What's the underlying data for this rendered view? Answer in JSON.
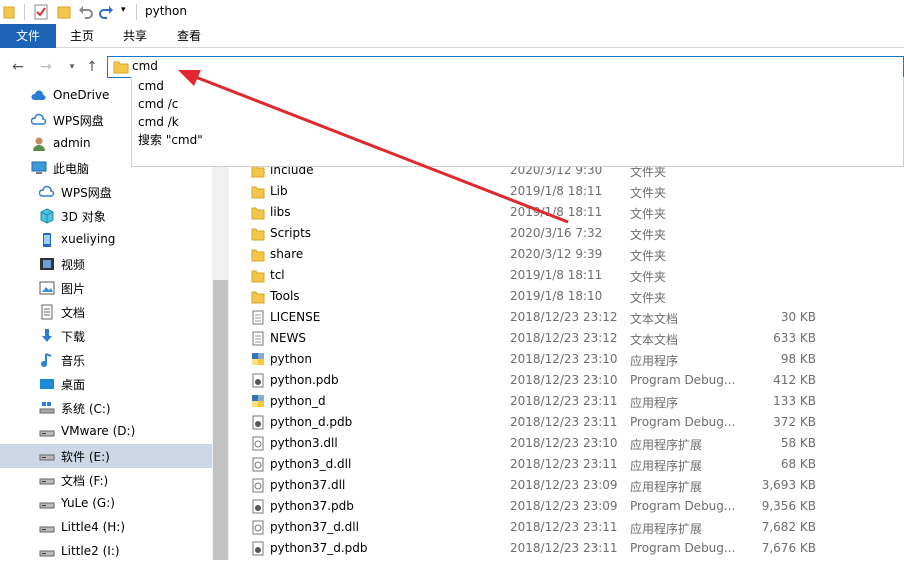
{
  "window": {
    "title": "python"
  },
  "ribbon": {
    "tabs": [
      "文件",
      "主页",
      "共享",
      "查看"
    ]
  },
  "address": {
    "value": "cmd",
    "suggestions": [
      "cmd",
      "cmd /c",
      "cmd /k",
      "搜索 \"cmd\""
    ]
  },
  "sidebar": {
    "items": [
      {
        "label": "OneDrive",
        "icon": "cloud-icon"
      },
      {
        "label": "WPS网盘",
        "icon": "wps-cloud-icon"
      },
      {
        "label": "admin",
        "icon": "user-icon"
      },
      {
        "label": "此电脑",
        "icon": "computer-icon"
      },
      {
        "label": "WPS网盘",
        "icon": "wps-cloud-icon"
      },
      {
        "label": "3D 对象",
        "icon": "cube-icon"
      },
      {
        "label": "xueliying",
        "icon": "phone-icon"
      },
      {
        "label": "视频",
        "icon": "video-icon"
      },
      {
        "label": "图片",
        "icon": "picture-icon"
      },
      {
        "label": "文档",
        "icon": "document-icon"
      },
      {
        "label": "下载",
        "icon": "download-icon"
      },
      {
        "label": "音乐",
        "icon": "music-icon"
      },
      {
        "label": "桌面",
        "icon": "desktop-icon"
      },
      {
        "label": "系统 (C:)",
        "icon": "system-drive-icon"
      },
      {
        "label": "VMware (D:)",
        "icon": "drive-icon"
      },
      {
        "label": "软件 (E:)",
        "icon": "drive-icon"
      },
      {
        "label": "文档 (F:)",
        "icon": "drive-icon"
      },
      {
        "label": "YuLe (G:)",
        "icon": "drive-icon"
      },
      {
        "label": "Little4 (H:)",
        "icon": "drive-icon"
      },
      {
        "label": "Little2 (I:)",
        "icon": "drive-icon"
      }
    ]
  },
  "files": [
    {
      "name": "include",
      "date": "2020/3/12 9:30",
      "type": "文件夹",
      "size": "",
      "icon": "folder-icon"
    },
    {
      "name": "Lib",
      "date": "2019/1/8 18:11",
      "type": "文件夹",
      "size": "",
      "icon": "folder-icon"
    },
    {
      "name": "libs",
      "date": "2019/1/8 18:11",
      "type": "文件夹",
      "size": "",
      "icon": "folder-icon"
    },
    {
      "name": "Scripts",
      "date": "2020/3/16 7:32",
      "type": "文件夹",
      "size": "",
      "icon": "folder-icon"
    },
    {
      "name": "share",
      "date": "2020/3/12 9:39",
      "type": "文件夹",
      "size": "",
      "icon": "folder-icon"
    },
    {
      "name": "tcl",
      "date": "2019/1/8 18:11",
      "type": "文件夹",
      "size": "",
      "icon": "folder-icon"
    },
    {
      "name": "Tools",
      "date": "2019/1/8 18:10",
      "type": "文件夹",
      "size": "",
      "icon": "folder-icon"
    },
    {
      "name": "LICENSE",
      "date": "2018/12/23 23:12",
      "type": "文本文档",
      "size": "30 KB",
      "icon": "text-file-icon"
    },
    {
      "name": "NEWS",
      "date": "2018/12/23 23:12",
      "type": "文本文档",
      "size": "633 KB",
      "icon": "text-file-icon"
    },
    {
      "name": "python",
      "date": "2018/12/23 23:10",
      "type": "应用程序",
      "size": "98 KB",
      "icon": "python-exe-icon"
    },
    {
      "name": "python.pdb",
      "date": "2018/12/23 23:10",
      "type": "Program Debug...",
      "size": "412 KB",
      "icon": "pdb-file-icon"
    },
    {
      "name": "python_d",
      "date": "2018/12/23 23:11",
      "type": "应用程序",
      "size": "133 KB",
      "icon": "python-exe-icon"
    },
    {
      "name": "python_d.pdb",
      "date": "2018/12/23 23:11",
      "type": "Program Debug...",
      "size": "372 KB",
      "icon": "pdb-file-icon"
    },
    {
      "name": "python3.dll",
      "date": "2018/12/23 23:10",
      "type": "应用程序扩展",
      "size": "58 KB",
      "icon": "dll-file-icon"
    },
    {
      "name": "python3_d.dll",
      "date": "2018/12/23 23:11",
      "type": "应用程序扩展",
      "size": "68 KB",
      "icon": "dll-file-icon"
    },
    {
      "name": "python37.dll",
      "date": "2018/12/23 23:09",
      "type": "应用程序扩展",
      "size": "3,693 KB",
      "icon": "dll-file-icon"
    },
    {
      "name": "python37.pdb",
      "date": "2018/12/23 23:09",
      "type": "Program Debug...",
      "size": "9,356 KB",
      "icon": "pdb-file-icon"
    },
    {
      "name": "python37_d.dll",
      "date": "2018/12/23 23:11",
      "type": "应用程序扩展",
      "size": "7,682 KB",
      "icon": "dll-file-icon"
    },
    {
      "name": "python37_d.pdb",
      "date": "2018/12/23 23:11",
      "type": "Program Debug...",
      "size": "7,676 KB",
      "icon": "pdb-file-icon"
    }
  ],
  "colors": {
    "accent": "#1a63b5",
    "annotation_arrow": "#e0282e",
    "folder": "#f3c64b"
  }
}
